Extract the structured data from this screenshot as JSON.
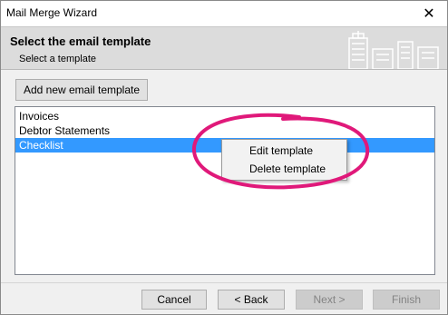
{
  "window": {
    "title": "Mail Merge Wizard",
    "close_glyph": "✕"
  },
  "header": {
    "title": "Select the email template",
    "subtitle": "Select a template"
  },
  "add_button_label": "Add new email template",
  "templates": [
    "Invoices",
    "Debtor Statements",
    "Checklist"
  ],
  "selected_template_index": 2,
  "context_menu": {
    "items": [
      "Edit template",
      "Delete template"
    ]
  },
  "footer": {
    "cancel_label": "Cancel",
    "back_label": "< Back",
    "next_label": "Next >",
    "finish_label": "Finish"
  },
  "colors": {
    "selection": "#3399ff",
    "highlight_ring": "#e0197a",
    "header_bg": "#dcdcdc"
  },
  "icons": [
    "close-icon",
    "city-skyline-illustration"
  ]
}
